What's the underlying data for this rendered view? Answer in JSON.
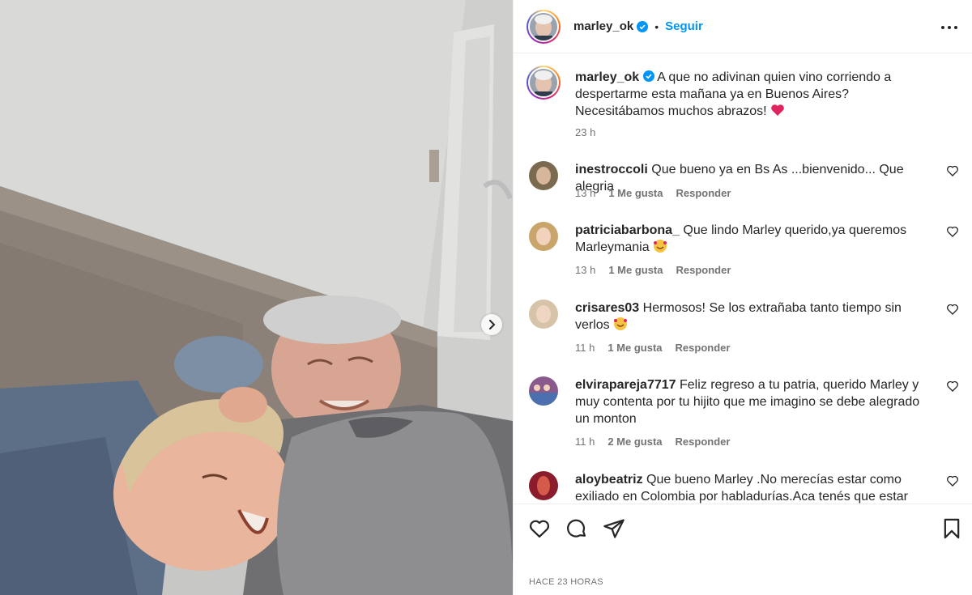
{
  "post": {
    "username": "marley_ok",
    "follow_label": "Seguir",
    "dot": "•",
    "caption": "A que no adivinan quien vino corriendo a despertarme esta mañana ya en Buenos Aires? Necesitábamos muchos abrazos!",
    "caption_time": "23 h",
    "posted_ago": "HACE 23 HORAS"
  },
  "comments": [
    {
      "username": "inestroccoli",
      "text": "Que bueno ya en Bs As ...bienvenido... Que alegria",
      "time": "13 h",
      "likes": "1 Me gusta",
      "reply": "Responder",
      "avatar_color": "#7a6a4f"
    },
    {
      "username": "patriciabarbona_",
      "text": "Que lindo Marley querido,ya queremos Marleymania",
      "time": "13 h",
      "likes": "1 Me gusta",
      "reply": "Responder",
      "avatar_color": "#c9a56c"
    },
    {
      "username": "crisares03",
      "text": "Hermosos! Se los extrañaba tanto tiempo sin verlos",
      "time": "11 h",
      "likes": "1 Me gusta",
      "reply": "Responder",
      "avatar_color": "#d6c3a8"
    },
    {
      "username": "elvirapareja7717",
      "text": "Feliz regreso a tu patria, querido Marley y muy contenta por tu hijito que me imagino se debe alegrado un monton",
      "time": "11 h",
      "likes": "2 Me gusta",
      "reply": "Responder",
      "avatar_color": "#8a5a8c"
    },
    {
      "username": "aloybeatriz",
      "text": "Que bueno Marley .No merecías estar como exiliado en Colombia por habladurías.Aca tenés que estar con",
      "time": "",
      "likes": "",
      "reply": "",
      "avatar_color": "#8b1c2c"
    }
  ],
  "icons": {
    "verified": "verified-badge-icon",
    "more": "more-options-icon",
    "like": "heart-icon",
    "comment": "comment-icon",
    "share": "share-icon",
    "save": "bookmark-icon",
    "next": "chevron-right-icon"
  },
  "colors": {
    "accent": "#0095f6",
    "heart_emoji": "#e0245e",
    "text": "#262626",
    "muted": "#737373"
  }
}
